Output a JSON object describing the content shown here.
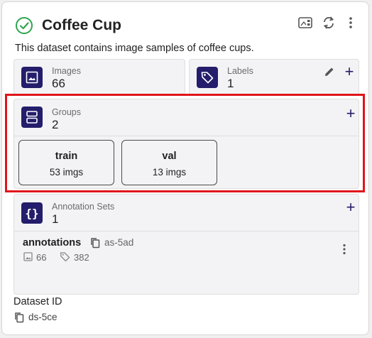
{
  "header": {
    "title": "Coffee Cup",
    "description": "This dataset contains image samples of coffee cups."
  },
  "stats": {
    "images": {
      "label": "Images",
      "count": "66"
    },
    "labels": {
      "label": "Labels",
      "count": "1"
    }
  },
  "groups": {
    "label": "Groups",
    "count": "2",
    "items": [
      {
        "name": "train",
        "count": "53 imgs"
      },
      {
        "name": "val",
        "count": "13 imgs"
      }
    ]
  },
  "annotation_sets": {
    "label": "Annotation Sets",
    "count": "1",
    "items": [
      {
        "name": "annotations",
        "id": "as-5ad",
        "images": "66",
        "labels": "382"
      }
    ]
  },
  "dataset": {
    "id_label": "Dataset ID",
    "id": "ds-5ce"
  },
  "colors": {
    "accent": "#241d6b",
    "success": "#2ea44f",
    "highlight": "#e0151b"
  }
}
